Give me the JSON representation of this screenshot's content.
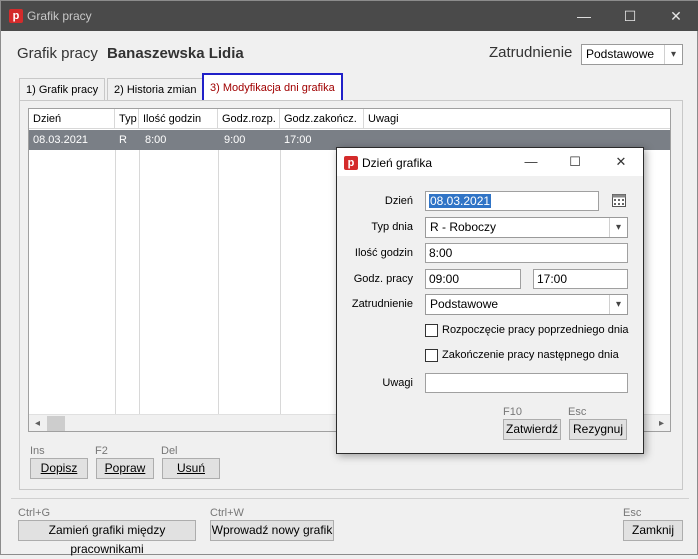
{
  "window": {
    "title": "Grafik pracy",
    "app_icon_letter": "p",
    "controls": {
      "minimize": "—",
      "maximize": "☐",
      "close": "✕"
    }
  },
  "header": {
    "title": "Grafik pracy",
    "employee": "Banaszewska Lidia",
    "employment_label": "Zatrudnienie",
    "employment_value": "Podstawowe"
  },
  "tabs": [
    {
      "label": "1) Grafik pracy"
    },
    {
      "label": "2) Historia zmian"
    },
    {
      "label": "3) Modyfikacja dni grafika"
    }
  ],
  "grid": {
    "columns": [
      "Dzień",
      "Typ",
      "Ilość godzin",
      "Godz.rozp.",
      "Godz.zakończ.",
      "Uwagi"
    ],
    "rows": [
      [
        "08.03.2021",
        "R",
        "8:00",
        "9:00",
        "17:00",
        ""
      ]
    ]
  },
  "row_actions": [
    {
      "hint": "Ins",
      "label": "Dopisz"
    },
    {
      "hint": "F2",
      "label": "Popraw"
    },
    {
      "hint": "Del",
      "label": "Usuń"
    }
  ],
  "bottom_actions": [
    {
      "hint": "Ctrl+G",
      "label": "Zamień grafiki między pracownikami"
    },
    {
      "hint": "Ctrl+W",
      "label": "Wprowadź nowy grafik"
    },
    {
      "hint": "Esc",
      "label": "Zamknij"
    }
  ],
  "dialog": {
    "title": "Dzień grafika",
    "app_icon_letter": "p",
    "controls": {
      "minimize": "—",
      "maximize": "☐",
      "close": "✕"
    },
    "fields": {
      "dzien_label": "Dzień",
      "dzien_value": "08.03.2021",
      "typ_label": "Typ dnia",
      "typ_value": "R - Roboczy",
      "ilosc_label": "Ilość godzin",
      "ilosc_value": "8:00",
      "godz_label": "Godz. pracy",
      "godz_from": "09:00",
      "godz_to": "17:00",
      "zatr_label": "Zatrudnienie",
      "zatr_value": "Podstawowe",
      "chk1_label": "Rozpoczęcie pracy poprzedniego dnia",
      "chk2_label": "Zakończenie pracy następnego dnia",
      "uwagi_label": "Uwagi",
      "uwagi_value": ""
    },
    "buttons": [
      {
        "hint": "F10",
        "label": "Zatwierdź"
      },
      {
        "hint": "Esc",
        "label": "Rezygnuj"
      }
    ]
  },
  "icons": {
    "calendar": "calendar-icon",
    "chevron": "▾",
    "scroll_left": "◂",
    "scroll_right": "▸"
  }
}
